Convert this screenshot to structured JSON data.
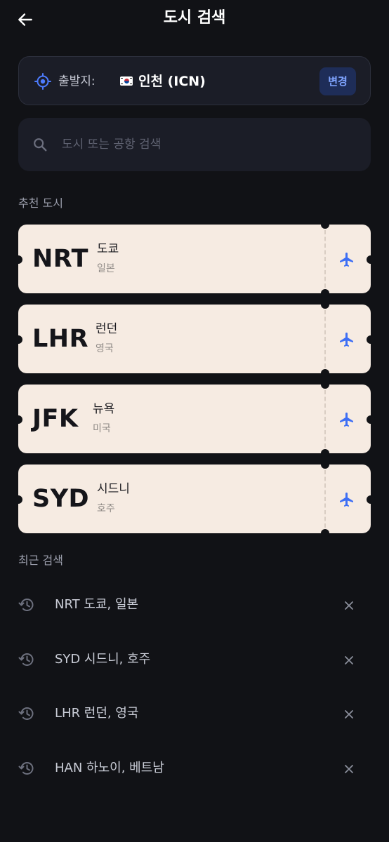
{
  "header": {
    "title": "도시 검색"
  },
  "origin": {
    "label": "출발지:",
    "value": "인천 (ICN)",
    "change_label": "변경",
    "flag_icon": "korea-flag-icon"
  },
  "search": {
    "placeholder": "도시 또는 공항 검색"
  },
  "recommended": {
    "title": "추천 도시",
    "items": [
      {
        "code": "NRT",
        "city": "도쿄",
        "country": "일본"
      },
      {
        "code": "LHR",
        "city": "런던",
        "country": "영국"
      },
      {
        "code": "JFK",
        "city": "뉴욕",
        "country": "미국"
      },
      {
        "code": "SYD",
        "city": "시드니",
        "country": "호주"
      }
    ]
  },
  "recent": {
    "title": "최근 검색",
    "items": [
      {
        "text": "NRT 도쿄, 일본"
      },
      {
        "text": "SYD 시드니, 호주"
      },
      {
        "text": "LHR 런던, 영국"
      },
      {
        "text": "HAN 하노이, 베트남"
      }
    ]
  },
  "colors": {
    "background": "#111216",
    "card": "#1b1d27",
    "ticket": "#f6ebe2",
    "accent": "#3d6ef5",
    "change_button_bg": "#1e2d58",
    "change_button_text": "#7fa4ff"
  }
}
